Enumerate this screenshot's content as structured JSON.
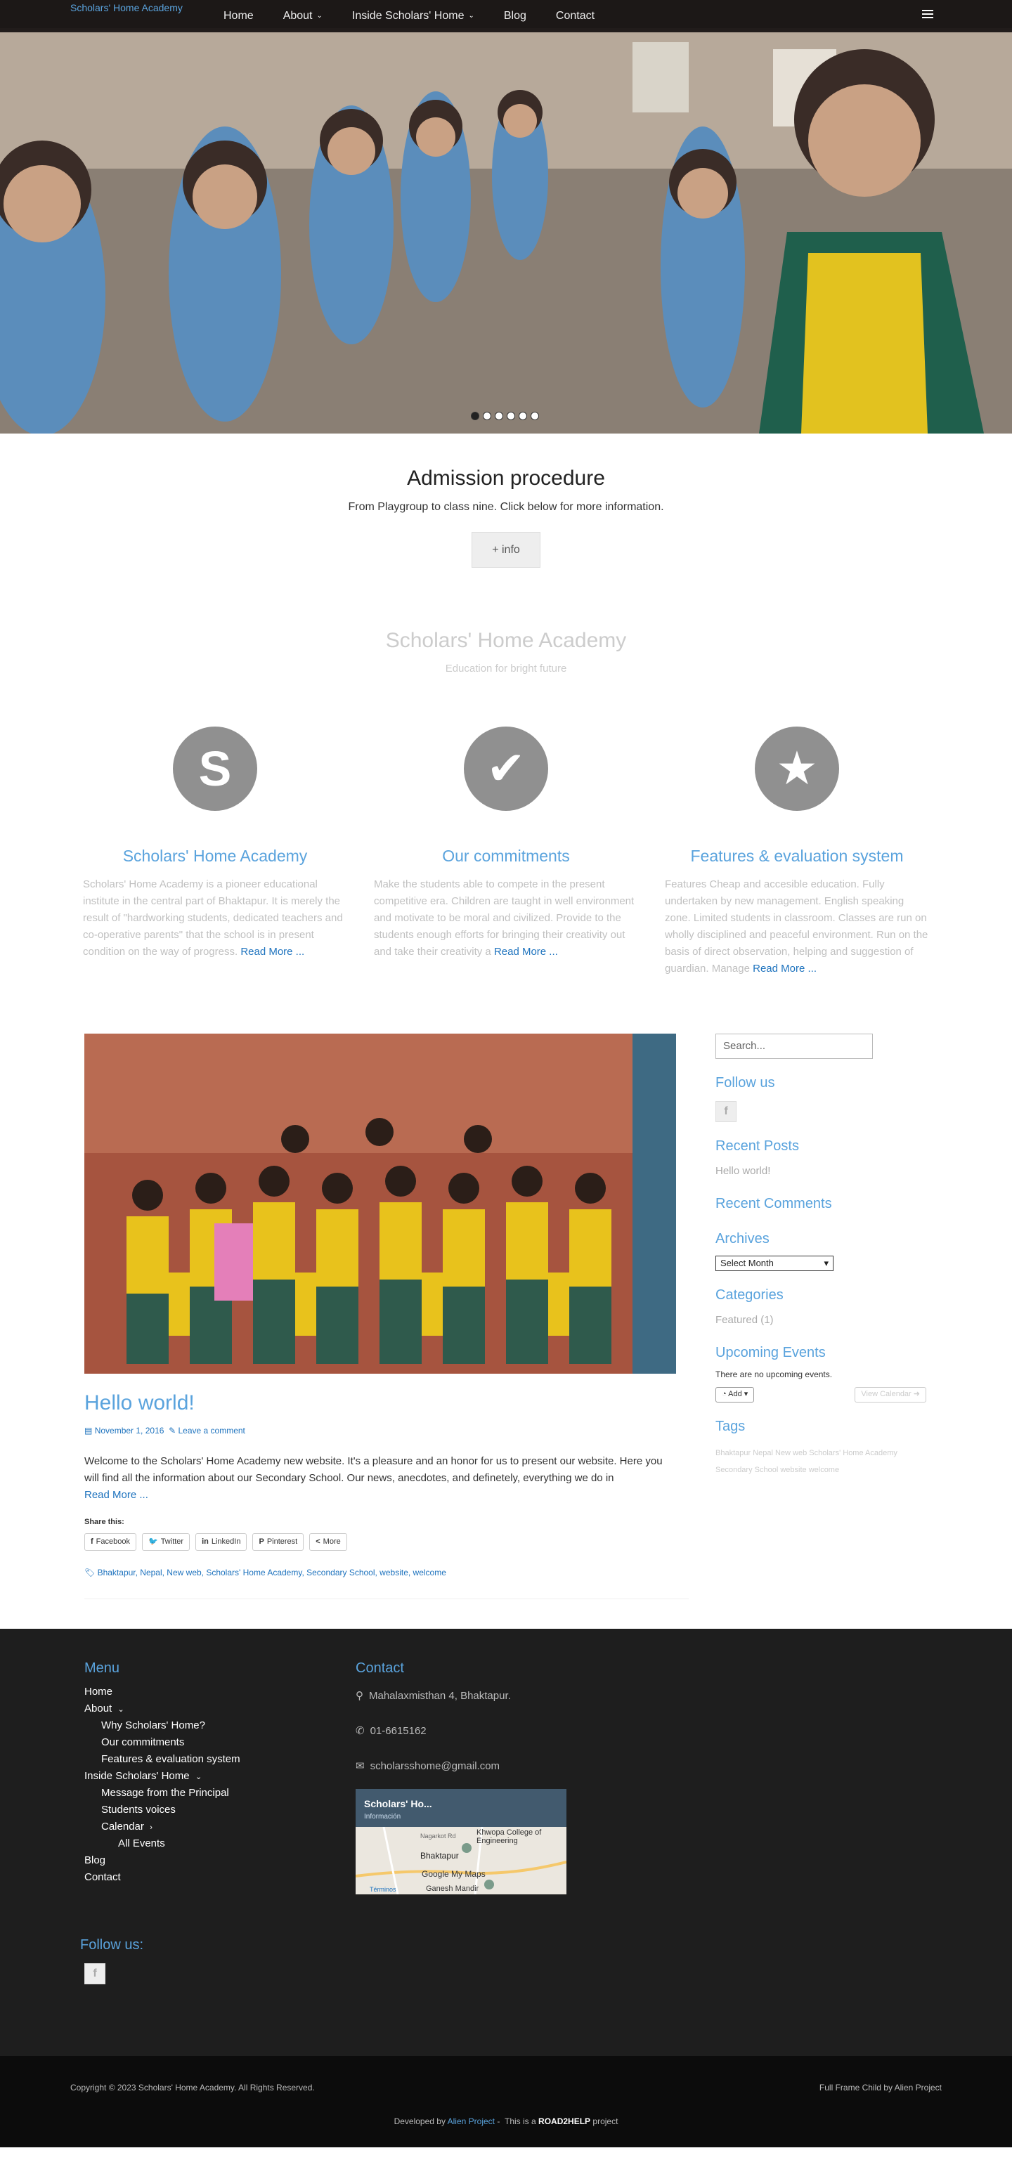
{
  "nav": {
    "logo_alt": "Scholars' Home Academy",
    "items": [
      {
        "label": "Home",
        "has_submenu": false
      },
      {
        "label": "About",
        "has_submenu": true
      },
      {
        "label": "Inside Scholars' Home",
        "has_submenu": true
      },
      {
        "label": "Blog",
        "has_submenu": false
      },
      {
        "label": "Contact",
        "has_submenu": false
      }
    ]
  },
  "hero": {
    "slide_count": 6,
    "active_slide": 1
  },
  "admission": {
    "title": "Admission procedure",
    "subtitle": "From Playgroup to class nine. Click below for more information.",
    "button": "+ info"
  },
  "academy": {
    "title": "Scholars' Home Academy",
    "tagline": "Education for bright future"
  },
  "features": [
    {
      "icon": "s-letter-icon",
      "glyph": "S",
      "title": "Scholars' Home Academy",
      "text": "Scholars' Home Academy is a pioneer educational institute in the central part of Bhaktapur. It is merely the result of \"hardworking students, dedicated teachers and co-operative parents\" that the school is in present condition on the way of progress.",
      "more": "Read More ..."
    },
    {
      "icon": "check-icon",
      "glyph": "✔",
      "title": "Our commitments",
      "text": "Make the students able to compete in the present competitive era. Children are taught in well environment and motivate to be moral and civilized. Provide to the students enough efforts for bringing their creativity out and take their creativity a",
      "more": "Read More ..."
    },
    {
      "icon": "star-icon",
      "glyph": "★",
      "title": "Features & evaluation system",
      "text": "Features Cheap and accesible education. Fully undertaken by new management. English speaking zone. Limited students in classroom. Classes are run on wholly disciplined and peaceful environment. Run on the basis of direct observation, helping and suggestion of guardian. Manage",
      "more": "Read More ..."
    }
  ],
  "post": {
    "title": "Hello world!",
    "date": "November 1, 2016",
    "comments": "Leave a comment",
    "excerpt": "Welcome to the Scholars' Home Academy new website. It's a pleasure and an honor for us to present our website. Here you will find all the information about our Secondary School. Our news, anecdotes, and definetely, everything we do in",
    "more": "Read More ...",
    "share_label": "Share this:",
    "share_buttons": [
      "Facebook",
      "Twitter",
      "LinkedIn",
      "Pinterest",
      "More"
    ],
    "tags": "Bhaktapur, Nepal, New web, Scholars' Home Academy, Secondary School, website, welcome"
  },
  "sidebar": {
    "search_placeholder": "Search...",
    "follow_title": "Follow us",
    "recent_posts_title": "Recent Posts",
    "recent_posts": [
      "Hello world!"
    ],
    "recent_comments_title": "Recent Comments",
    "archives_title": "Archives",
    "archives_select": "Select Month",
    "categories_title": "Categories",
    "categories": [
      "Featured (1)"
    ],
    "events_title": "Upcoming Events",
    "events_note": "There are no upcoming events.",
    "add_label": "Add",
    "view_calendar": "View Calendar",
    "tags_title": "Tags",
    "tags": "Bhaktapur Nepal New web Scholars' Home Academy Secondary School website welcome"
  },
  "footer": {
    "menu_title": "Menu",
    "menu": [
      {
        "label": "Home",
        "level": 1
      },
      {
        "label": "About",
        "level": 1,
        "chev": "⌄"
      },
      {
        "label": "Why Scholars' Home?",
        "level": 2
      },
      {
        "label": "Our commitments",
        "level": 2
      },
      {
        "label": "Features & evaluation system",
        "level": 2
      },
      {
        "label": "Inside Scholars' Home",
        "level": 1,
        "chev": "⌄"
      },
      {
        "label": "Message from the Principal",
        "level": 2
      },
      {
        "label": "Students voices",
        "level": 2
      },
      {
        "label": "Calendar",
        "level": 2,
        "chev": "›"
      },
      {
        "label": "All Events",
        "level": 3
      },
      {
        "label": "Blog",
        "level": 1
      },
      {
        "label": "Contact",
        "level": 1
      }
    ],
    "contact_title": "Contact",
    "address": "Mahalaxmisthan 4, Bhaktapur.",
    "phone": "01-6615162",
    "email": "scholarsshome@gmail.com",
    "map": {
      "title": "Scholars' Ho...",
      "subtitle": "Información",
      "labels": [
        "Khwopa College of Engineering",
        "Bhaktapur",
        "Nagarkot Rd",
        "Ganesh Mandir",
        "Google My Maps",
        "Términos"
      ]
    },
    "follow_title": "Follow us:",
    "copyright": "Copyright © 2023 Scholars' Home Academy. All Rights Reserved.",
    "theme_credit": "Full Frame Child by Alien Project",
    "developed_by": "Developed by",
    "developer": "Alien Project",
    "separator": "-",
    "this_is_a": "This is a",
    "brand": "ROAD2HELP",
    "project": "project"
  }
}
